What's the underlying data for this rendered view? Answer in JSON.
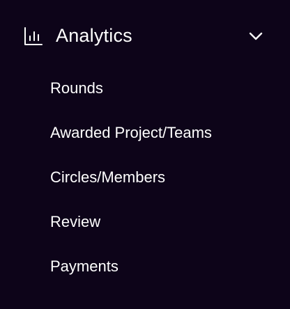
{
  "nav": {
    "group_title": "Analytics",
    "group_icon": "bar-chart-icon",
    "toggle_icon": "chevron-down-icon",
    "items": [
      {
        "label": "Rounds"
      },
      {
        "label": "Awarded Project/Teams"
      },
      {
        "label": "Circles/Members"
      },
      {
        "label": "Review"
      },
      {
        "label": "Payments"
      }
    ]
  },
  "colors": {
    "background": "#0d0419",
    "text": "#ffffff"
  }
}
